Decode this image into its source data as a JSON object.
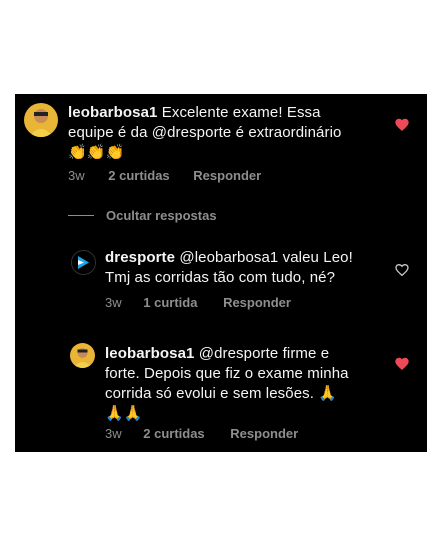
{
  "colors": {
    "heart_liked": "#ed4956",
    "background": "#000000",
    "muted": "#8e8e8e"
  },
  "comments": [
    {
      "username": "leobarbosa1",
      "line1": "Excelente exame! Essa",
      "line2": "equipe é da @dresporte é extraordinário",
      "emoji": "👏👏👏",
      "time": "3w",
      "likes": "2 curtidas",
      "reply": "Responder",
      "liked": true,
      "icon": "heart-filled-icon"
    }
  ],
  "hide_replies": "Ocultar respostas",
  "replies": [
    {
      "username": "dresporte",
      "line1": "@leobarbosa1 valeu Leo!",
      "line2": "Tmj as corridas tão com tudo, né?",
      "time": "3w",
      "likes": "1 curtida",
      "reply": "Responder",
      "liked": false,
      "icon": "heart-outline-icon"
    },
    {
      "username": "leobarbosa1",
      "line1": "@dresporte firme e",
      "line2": "forte. Depois que fiz o exame minha",
      "line3": "corrida só evolui e sem lesões. 🙏",
      "emoji": "🙏🙏",
      "time": "3w",
      "likes": "2 curtidas",
      "reply": "Responder",
      "liked": true,
      "icon": "heart-filled-icon"
    }
  ]
}
